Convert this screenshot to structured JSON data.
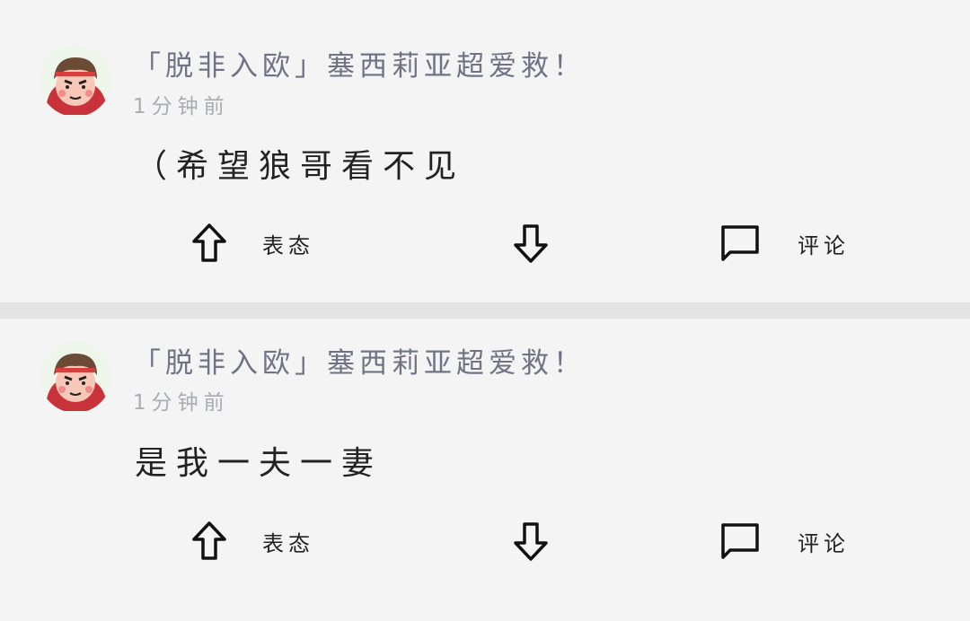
{
  "posts": [
    {
      "username": "「脱非入欧」塞西莉亚超爱救！",
      "time": "1分钟前",
      "content": "（希望狼哥看不见",
      "actions": {
        "react_label": "表态",
        "comment_label": "评论"
      }
    },
    {
      "username": "「脱非入欧」塞西莉亚超爱救！",
      "time": "1分钟前",
      "content": "是我一夫一妻",
      "actions": {
        "react_label": "表态",
        "comment_label": "评论"
      }
    }
  ],
  "icons": {
    "upvote": "arrow-up-outline-icon",
    "downvote": "arrow-down-outline-icon",
    "comment": "speech-bubble-icon"
  },
  "colors": {
    "background": "#f4f4f4",
    "divider": "#e4e4e4",
    "username": "#6f7384",
    "timestamp": "#a9acb3",
    "text": "#222222"
  }
}
